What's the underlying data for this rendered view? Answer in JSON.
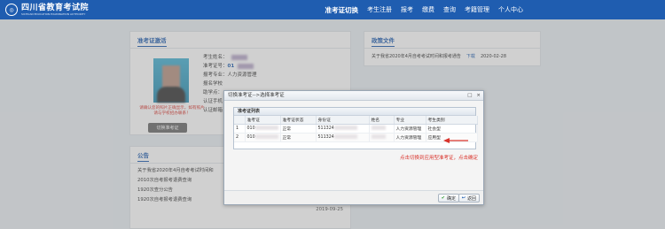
{
  "header": {
    "logo_text": "四川省教育考试院",
    "logo_subtext": "SICHUAN EDUCATION EXAMINATION AUTHORITY",
    "nav": [
      "准考证切换",
      "考生注册",
      "报考",
      "缴费",
      "查询",
      "考籍管理",
      "个人中心"
    ],
    "active_nav": "准考证切换"
  },
  "ticket_panel": {
    "title": "准考证激活",
    "name_label": "考生姓名：",
    "ticket_label": "准考证号：",
    "ticket_value": "01",
    "fields": [
      "报考专业：人力资源管理",
      "报名学校",
      "助学点：",
      "认证手机",
      "认证邮箱"
    ],
    "warning": "请确认您的照片正确显示，如有照片请与学校招办联系！",
    "switch_button": "切换准考证"
  },
  "notice_panel": {
    "title": "公告",
    "items": [
      {
        "text": "关于我省2020年4月自考考试时间和",
        "date": ""
      },
      {
        "text": "2010次自考报考退费查询",
        "date": ""
      },
      {
        "text": "1920次查分公告",
        "date": ""
      },
      {
        "text": "1920次自考报考退费查询",
        "date": ""
      },
      {
        "text": "",
        "date": "2019-09-25"
      }
    ]
  },
  "policy_panel": {
    "title": "政策文件",
    "item_text": "关于我省2020年4月自考考试时间和报考通告",
    "download": "下载",
    "date": "2020-02-28"
  },
  "dialog": {
    "title": "切换准考证-->选择准考证",
    "controls": [
      "□",
      "×"
    ],
    "grid_caption": "准考证列表",
    "columns": [
      "",
      "准考证",
      "准考证状态",
      "身份证",
      "姓名",
      "专业",
      "考生类别"
    ],
    "rows": [
      {
        "index": "1",
        "ticket": "010",
        "status": "正常",
        "id_card": "511324",
        "name": "",
        "major": "人力资源管理",
        "type": "社会型"
      },
      {
        "index": "2",
        "ticket": "010",
        "status": "正常",
        "id_card": "511324",
        "name": "",
        "major": "人力资源管理",
        "type": "应用型"
      }
    ],
    "hint": "点击切换到应用型准考证，点击确定",
    "ok_button": "确定",
    "back_button": "返回"
  },
  "colors": {
    "brand": "#1f5db0",
    "warning": "#d9332b"
  }
}
